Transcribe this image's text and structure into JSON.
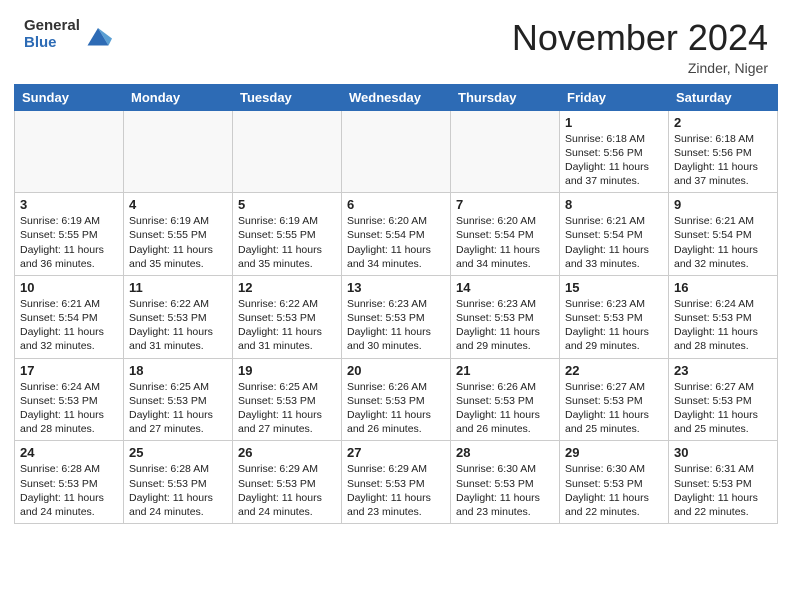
{
  "header": {
    "logo_general": "General",
    "logo_blue": "Blue",
    "month_title": "November 2024",
    "location": "Zinder, Niger"
  },
  "days_of_week": [
    "Sunday",
    "Monday",
    "Tuesday",
    "Wednesday",
    "Thursday",
    "Friday",
    "Saturday"
  ],
  "weeks": [
    [
      {
        "day": "",
        "info": ""
      },
      {
        "day": "",
        "info": ""
      },
      {
        "day": "",
        "info": ""
      },
      {
        "day": "",
        "info": ""
      },
      {
        "day": "",
        "info": ""
      },
      {
        "day": "1",
        "info": "Sunrise: 6:18 AM\nSunset: 5:56 PM\nDaylight: 11 hours and 37 minutes."
      },
      {
        "day": "2",
        "info": "Sunrise: 6:18 AM\nSunset: 5:56 PM\nDaylight: 11 hours and 37 minutes."
      }
    ],
    [
      {
        "day": "3",
        "info": "Sunrise: 6:19 AM\nSunset: 5:55 PM\nDaylight: 11 hours and 36 minutes."
      },
      {
        "day": "4",
        "info": "Sunrise: 6:19 AM\nSunset: 5:55 PM\nDaylight: 11 hours and 35 minutes."
      },
      {
        "day": "5",
        "info": "Sunrise: 6:19 AM\nSunset: 5:55 PM\nDaylight: 11 hours and 35 minutes."
      },
      {
        "day": "6",
        "info": "Sunrise: 6:20 AM\nSunset: 5:54 PM\nDaylight: 11 hours and 34 minutes."
      },
      {
        "day": "7",
        "info": "Sunrise: 6:20 AM\nSunset: 5:54 PM\nDaylight: 11 hours and 34 minutes."
      },
      {
        "day": "8",
        "info": "Sunrise: 6:21 AM\nSunset: 5:54 PM\nDaylight: 11 hours and 33 minutes."
      },
      {
        "day": "9",
        "info": "Sunrise: 6:21 AM\nSunset: 5:54 PM\nDaylight: 11 hours and 32 minutes."
      }
    ],
    [
      {
        "day": "10",
        "info": "Sunrise: 6:21 AM\nSunset: 5:54 PM\nDaylight: 11 hours and 32 minutes."
      },
      {
        "day": "11",
        "info": "Sunrise: 6:22 AM\nSunset: 5:53 PM\nDaylight: 11 hours and 31 minutes."
      },
      {
        "day": "12",
        "info": "Sunrise: 6:22 AM\nSunset: 5:53 PM\nDaylight: 11 hours and 31 minutes."
      },
      {
        "day": "13",
        "info": "Sunrise: 6:23 AM\nSunset: 5:53 PM\nDaylight: 11 hours and 30 minutes."
      },
      {
        "day": "14",
        "info": "Sunrise: 6:23 AM\nSunset: 5:53 PM\nDaylight: 11 hours and 29 minutes."
      },
      {
        "day": "15",
        "info": "Sunrise: 6:23 AM\nSunset: 5:53 PM\nDaylight: 11 hours and 29 minutes."
      },
      {
        "day": "16",
        "info": "Sunrise: 6:24 AM\nSunset: 5:53 PM\nDaylight: 11 hours and 28 minutes."
      }
    ],
    [
      {
        "day": "17",
        "info": "Sunrise: 6:24 AM\nSunset: 5:53 PM\nDaylight: 11 hours and 28 minutes."
      },
      {
        "day": "18",
        "info": "Sunrise: 6:25 AM\nSunset: 5:53 PM\nDaylight: 11 hours and 27 minutes."
      },
      {
        "day": "19",
        "info": "Sunrise: 6:25 AM\nSunset: 5:53 PM\nDaylight: 11 hours and 27 minutes."
      },
      {
        "day": "20",
        "info": "Sunrise: 6:26 AM\nSunset: 5:53 PM\nDaylight: 11 hours and 26 minutes."
      },
      {
        "day": "21",
        "info": "Sunrise: 6:26 AM\nSunset: 5:53 PM\nDaylight: 11 hours and 26 minutes."
      },
      {
        "day": "22",
        "info": "Sunrise: 6:27 AM\nSunset: 5:53 PM\nDaylight: 11 hours and 25 minutes."
      },
      {
        "day": "23",
        "info": "Sunrise: 6:27 AM\nSunset: 5:53 PM\nDaylight: 11 hours and 25 minutes."
      }
    ],
    [
      {
        "day": "24",
        "info": "Sunrise: 6:28 AM\nSunset: 5:53 PM\nDaylight: 11 hours and 24 minutes."
      },
      {
        "day": "25",
        "info": "Sunrise: 6:28 AM\nSunset: 5:53 PM\nDaylight: 11 hours and 24 minutes."
      },
      {
        "day": "26",
        "info": "Sunrise: 6:29 AM\nSunset: 5:53 PM\nDaylight: 11 hours and 24 minutes."
      },
      {
        "day": "27",
        "info": "Sunrise: 6:29 AM\nSunset: 5:53 PM\nDaylight: 11 hours and 23 minutes."
      },
      {
        "day": "28",
        "info": "Sunrise: 6:30 AM\nSunset: 5:53 PM\nDaylight: 11 hours and 23 minutes."
      },
      {
        "day": "29",
        "info": "Sunrise: 6:30 AM\nSunset: 5:53 PM\nDaylight: 11 hours and 22 minutes."
      },
      {
        "day": "30",
        "info": "Sunrise: 6:31 AM\nSunset: 5:53 PM\nDaylight: 11 hours and 22 minutes."
      }
    ]
  ]
}
